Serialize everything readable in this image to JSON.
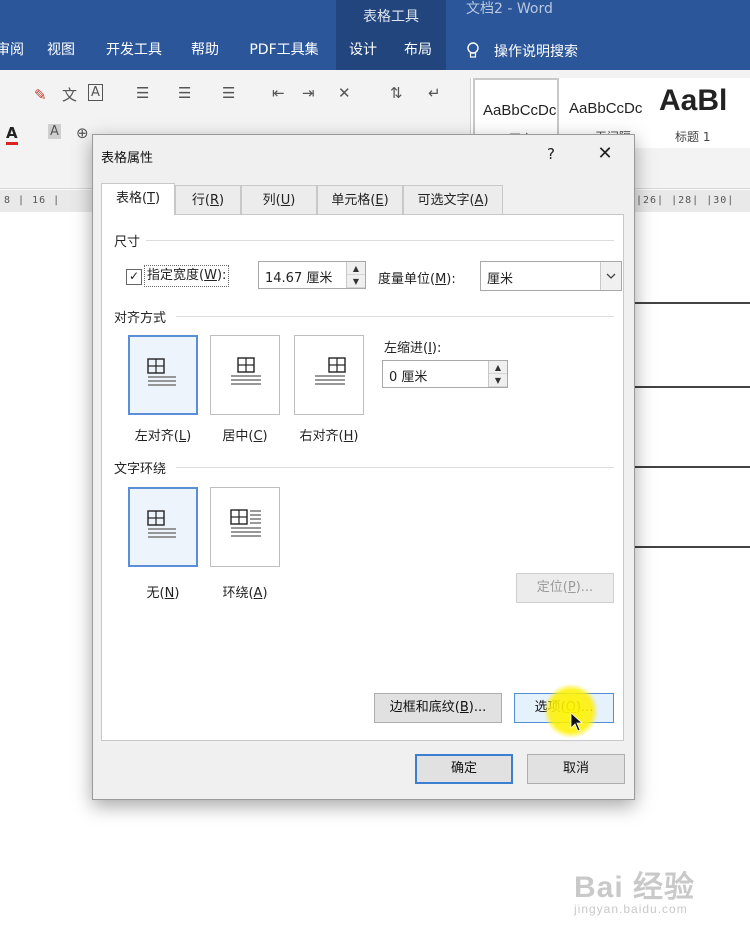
{
  "ribbon": {
    "context_group": "表格工具",
    "doc_title": "文档2  -  Word",
    "tabs": [
      {
        "label": "审阅"
      },
      {
        "label": "视图"
      },
      {
        "label": "开发工具"
      },
      {
        "label": "帮助"
      },
      {
        "label": "PDF工具集"
      },
      {
        "label": "设计"
      },
      {
        "label": "布局"
      }
    ],
    "search_label": "操作说明搜索",
    "styles": [
      {
        "sample": "AaBbCcDc",
        "name": "→ 正文"
      },
      {
        "sample": "AaBbCcDc",
        "name": "→ 无间隔"
      },
      {
        "sample": "AaBl",
        "name": "标题 1"
      }
    ]
  },
  "ruler": {
    "left_marks": "8  |  16  |  ",
    "right_marks": "|26|  |28|  |30|"
  },
  "dialog": {
    "title": "表格属性",
    "help": "?",
    "close": "✕",
    "tabs": [
      {
        "pre": "表格(",
        "key": "T",
        "post": ")"
      },
      {
        "pre": "行(",
        "key": "R",
        "post": ")"
      },
      {
        "pre": "列(",
        "key": "U",
        "post": ")"
      },
      {
        "pre": "单元格(",
        "key": "E",
        "post": ")"
      },
      {
        "pre": "可选文字(",
        "key": "A",
        "post": ")"
      }
    ],
    "size": {
      "section": "尺寸",
      "check_mark": "✓",
      "pref_width_pre": "指定宽度(",
      "pref_width_key": "W",
      "pref_width_post": "):",
      "width_value": "14.67 厘米",
      "unit_pre": "度量单位(",
      "unit_key": "M",
      "unit_post": "):",
      "unit_value": "厘米"
    },
    "alignment": {
      "section": "对齐方式",
      "options": [
        {
          "pre": "左对齐(",
          "key": "L",
          "post": ")"
        },
        {
          "pre": "居中(",
          "key": "C",
          "post": ")"
        },
        {
          "pre": "右对齐(",
          "key": "H",
          "post": ")"
        }
      ],
      "indent_pre": "左缩进(",
      "indent_key": "I",
      "indent_post": "):",
      "indent_value": "0 厘米"
    },
    "wrapping": {
      "section": "文字环绕",
      "options": [
        {
          "pre": "无(",
          "key": "N",
          "post": ")"
        },
        {
          "pre": "环绕(",
          "key": "A",
          "post": ")"
        }
      ],
      "position_pre": "定位(",
      "position_key": "P",
      "position_post": ")..."
    },
    "buttons": {
      "borders_pre": "边框和底纹(",
      "borders_key": "B",
      "borders_post": ")...",
      "options_pre": "选项(",
      "options_key": "O",
      "options_post": ")...",
      "ok": "确定",
      "cancel": "取消"
    }
  },
  "watermark": {
    "top": "Bai 经验",
    "bottom": "jingyan.baidu.com"
  },
  "colors": {
    "ribbon_blue": "#2b579a",
    "context_blue": "#21457c",
    "selection_blue": "#5b8ed6",
    "highlight_yellow": "#fff200"
  }
}
